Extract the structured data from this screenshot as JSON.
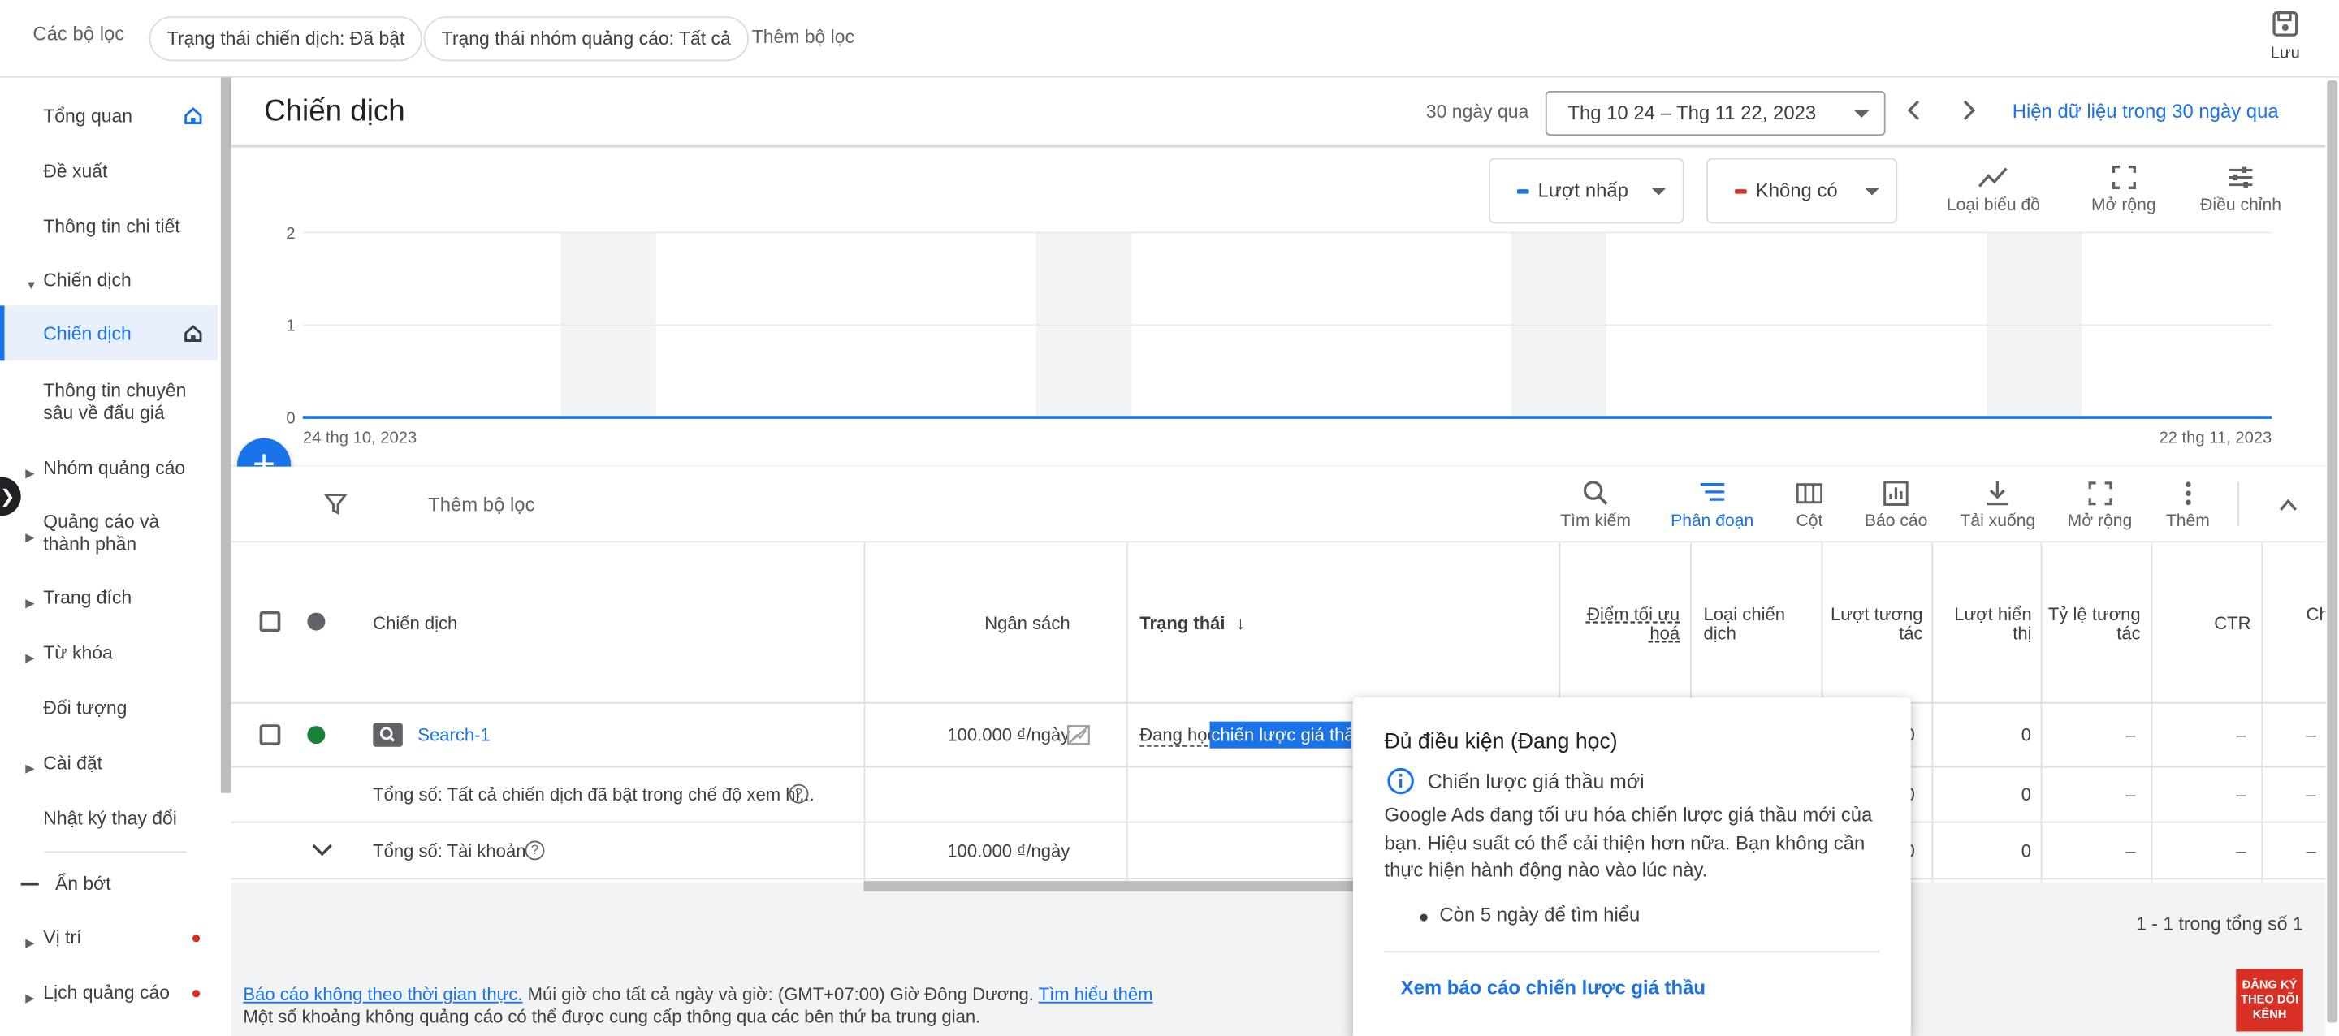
{
  "filters": {
    "label": "Các bộ lọc",
    "chips": [
      "Trạng thái chiến dịch: Đã bật",
      "Trạng thái nhóm quảng cáo: Tất cả"
    ],
    "add": "Thêm bộ lọc",
    "save": "Lưu"
  },
  "sidebar": {
    "items": [
      {
        "label": "Tổng quan"
      },
      {
        "label": "Đề xuất"
      },
      {
        "label": "Thông tin chi tiết"
      },
      {
        "label": "Chiến dịch"
      },
      {
        "label": "Chiến dịch"
      },
      {
        "label": "Thông tin chuyên sâu về đấu giá"
      },
      {
        "label": "Nhóm quảng cáo"
      },
      {
        "label": "Quảng cáo và thành phần"
      },
      {
        "label": "Trang đích"
      },
      {
        "label": "Từ khóa"
      },
      {
        "label": "Đối tượng"
      },
      {
        "label": "Cài đặt"
      },
      {
        "label": "Nhật ký thay đổi"
      },
      {
        "label": "Ẩn bớt"
      },
      {
        "label": "Vị trí"
      },
      {
        "label": "Lịch quảng cáo"
      }
    ]
  },
  "header": {
    "title": "Chiến dịch",
    "range_label": "30 ngày qua",
    "date_range": "Thg 10 24 – Thg 11 22, 2023",
    "show_data": "Hiện dữ liệu trong 30 ngày qua"
  },
  "chart": {
    "metric1": "Lượt nhấp",
    "metric2": "Không có",
    "tools": [
      "Loại biểu đồ",
      "Mở rộng",
      "Điều chỉnh"
    ],
    "colors": {
      "metric1": "#1a73e8",
      "metric2": "#d93025"
    }
  },
  "chart_data": {
    "type": "line",
    "x_start": "24 thg 10, 2023",
    "x_end": "22 thg 11, 2023",
    "yticks": [
      "2",
      "1",
      "0"
    ],
    "ylim": [
      0,
      2
    ],
    "series": [
      {
        "name": "Lượt nhấp",
        "values": [
          0,
          0,
          0,
          0,
          0,
          0,
          0,
          0,
          0,
          0,
          0,
          0,
          0,
          0,
          0,
          0,
          0,
          0,
          0,
          0,
          0,
          0,
          0,
          0,
          0,
          0,
          0,
          0,
          0,
          0
        ]
      }
    ]
  },
  "toolbar": {
    "add_filter": "Thêm bộ lọc",
    "items": [
      "Tìm kiếm",
      "Phân đoạn",
      "Cột",
      "Báo cáo",
      "Tải xuống",
      "Mở rộng",
      "Thêm"
    ]
  },
  "table": {
    "headers": {
      "campaign": "Chiến dịch",
      "budget": "Ngân sách",
      "status": "Trạng thái",
      "score": "Điểm tối ưu hoá",
      "type": "Loại chiến dịch",
      "interactions": "Lượt tương tác",
      "impressions": "Lượt hiển thị",
      "rate": "Tỷ lệ tương tác",
      "ctr": "CTR",
      "extra": "Ch tr..."
    },
    "row": {
      "name": "Search-1",
      "budget": "100.000 ₫/ngày",
      "status_a": "Đang học",
      "status_b": "chiến lược giá thầu",
      "interactions": "0",
      "impressions": "0",
      "rate": "–",
      "ctr": "–"
    },
    "total1": {
      "label": "Tổng số: Tất cả chiến dịch đã bật trong chế độ xem hi...",
      "interactions": "0",
      "impressions": "0",
      "rate": "–",
      "ctr": "–"
    },
    "total2": {
      "label": "Tổng số: Tài khoản",
      "budget": "100.000 ₫/ngày",
      "interactions": "0",
      "impressions": "0",
      "rate": "–",
      "ctr": "–"
    },
    "pager": "1 - 1 trong tổng số 1"
  },
  "footer": {
    "link1": "Báo cáo không theo thời gian thực.",
    "text1": "Múi giờ cho tất cả ngày và giờ: (GMT+07:00) Giờ Đông Dương.",
    "link2": "Tìm hiểu thêm",
    "text2": "Một số khoảng không quảng cáo có thể được cung cấp thông qua các bên thứ ba trung gian."
  },
  "popup": {
    "title": "Đủ điều kiện (Đang học)",
    "subtitle": "Chiến lược giá thầu mới",
    "body": "Google Ads đang tối ưu hóa chiến lược giá thầu mới của bạn. Hiệu suất có thể cải thiện hơn nữa. Bạn không cần thực hiện hành động nào vào lúc này.",
    "bullet": "Còn 5 ngày để tìm hiểu",
    "link": "Xem báo cáo chiến lược giá thầu"
  },
  "badge": "ĐĂNG KÝ THEO DÕI KÊNH"
}
